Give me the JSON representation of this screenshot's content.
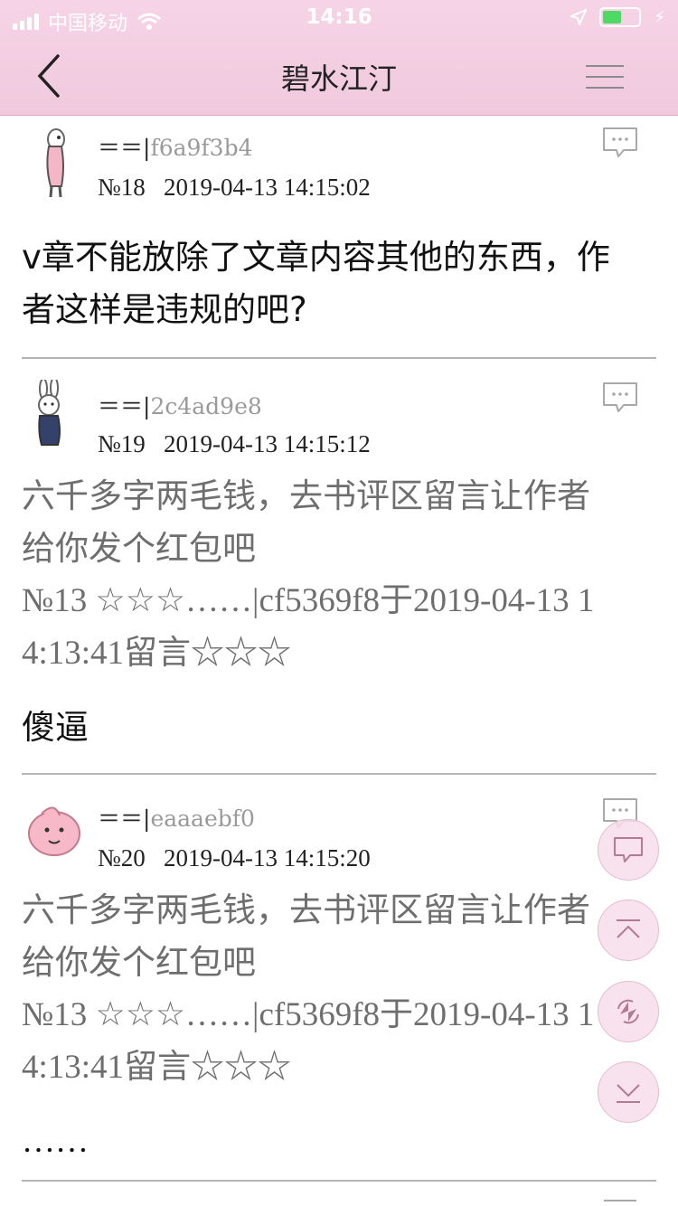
{
  "status_bar": {
    "carrier": "中国移动",
    "time": "14:16"
  },
  "header": {
    "title": "碧水江汀",
    "back_icon": "chevron-left-icon",
    "menu_icon": "hamburger-icon"
  },
  "posts": [
    {
      "user_prefix": "＝＝|",
      "user_id": "f6a9f3b4",
      "number": "№18",
      "datetime": "2019-04-13 14:15:02",
      "lines": [
        "v章不能放除了文章内容其他的东西，作",
        "者这样是违规的吧?"
      ],
      "tone": "dark"
    },
    {
      "user_prefix": "＝＝|",
      "user_id": "2c4ad9e8",
      "number": "№19",
      "datetime": "2019-04-13 14:15:12",
      "quote_lines": [
        "六千多字两毛钱，去书评区留言让作者",
        "给你发个红包吧",
        "№13 ☆☆☆……|cf5369f8于2019-04-13 1",
        "4:13:41留言☆☆☆"
      ],
      "reply": "傻逼"
    },
    {
      "user_prefix": "＝＝|",
      "user_id": "eaaaebf0",
      "number": "№20",
      "datetime": "2019-04-13 14:15:20",
      "quote_lines": [
        "六千多字两毛钱，去书评区留言让作者",
        "给你发个红包吧",
        "№13 ☆☆☆……|cf5369f8于2019-04-13 1",
        "4:13:41留言☆☆☆"
      ],
      "reply": "……"
    }
  ],
  "floating_buttons": [
    "comment-icon",
    "scroll-top-icon",
    "refresh-icon",
    "scroll-bottom-icon"
  ]
}
